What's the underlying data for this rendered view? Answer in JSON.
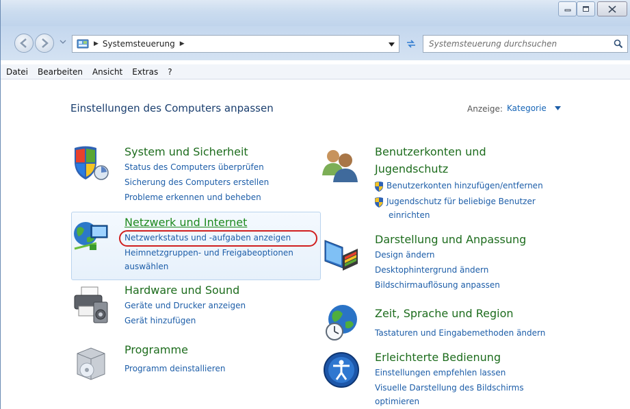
{
  "titlebar": {
    "buttons": {
      "minimize": "minimize",
      "maximize": "maximize",
      "close": "close"
    }
  },
  "address": {
    "breadcrumb": "Systemsteuerung",
    "search_placeholder": "Systemsteuerung durchsuchen"
  },
  "menu": [
    "Datei",
    "Bearbeiten",
    "Ansicht",
    "Extras",
    "?"
  ],
  "content": {
    "page_title": "Einstellungen des Computers anpassen",
    "view_label": "Anzeige:",
    "view_value": "Kategorie"
  },
  "categories": {
    "system": {
      "title": "System und Sicherheit",
      "links": [
        "Status des Computers überprüfen",
        "Sicherung des Computers erstellen",
        "Probleme erkennen und beheben"
      ]
    },
    "network": {
      "title": "Netzwerk und Internet",
      "links": [
        "Netzwerkstatus und -aufgaben anzeigen",
        "Heimnetzgruppen- und Freigabeoptionen",
        "auswählen"
      ]
    },
    "hardware": {
      "title": "Hardware und Sound",
      "links": [
        "Geräte und Drucker anzeigen",
        "Gerät hinzufügen"
      ]
    },
    "programs": {
      "title": "Programme",
      "links": [
        "Programm deinstallieren"
      ]
    },
    "accounts": {
      "title_line1": "Benutzerkonten und",
      "title_line2": "Jugendschutz",
      "links": [
        "Benutzerkonten hinzufügen/entfernen",
        "Jugendschutz für beliebige Benutzer",
        "einrichten"
      ]
    },
    "appearance": {
      "title": "Darstellung und Anpassung",
      "links": [
        "Design ändern",
        "Desktophintergrund ändern",
        "Bildschirmauflösung anpassen"
      ]
    },
    "clock": {
      "title": "Zeit, Sprache und Region",
      "links": [
        "Tastaturen und Eingabemethoden ändern"
      ]
    },
    "ease": {
      "title": "Erleichterte Bedienung",
      "links": [
        "Einstellungen empfehlen lassen",
        "Visuelle Darstellung des Bildschirms",
        "optimieren"
      ]
    }
  },
  "colors": {
    "link": "#1c5da8",
    "category_title": "#1d6c1d",
    "highlight_ring": "#d01e1e"
  }
}
